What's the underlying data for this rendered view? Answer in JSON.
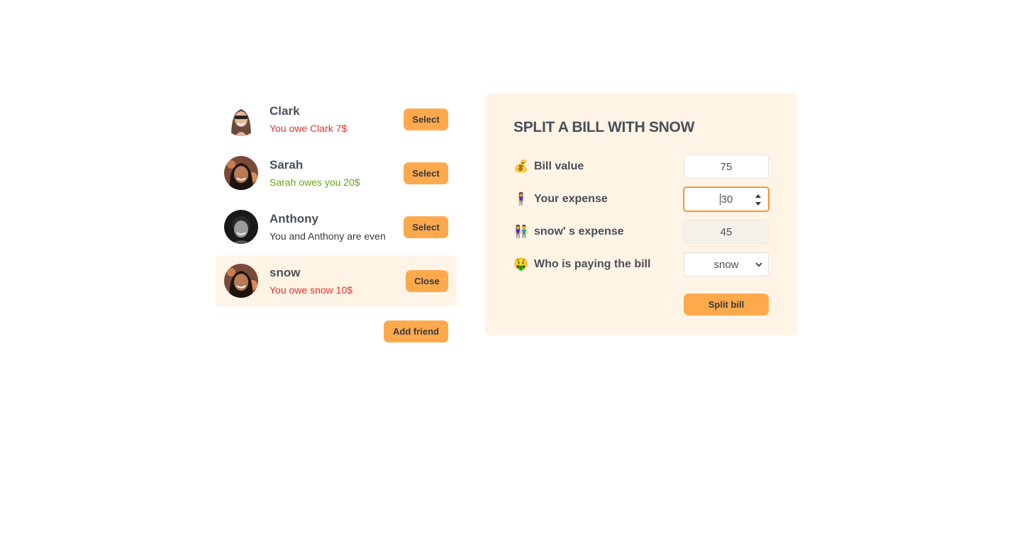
{
  "friends": [
    {
      "name": "Clark",
      "status": "You owe Clark 7$",
      "status_type": "red",
      "button": "Select",
      "selected": false
    },
    {
      "name": "Sarah",
      "status": "Sarah owes you 20$",
      "status_type": "green",
      "button": "Select",
      "selected": false
    },
    {
      "name": "Anthony",
      "status": "You and Anthony are even",
      "status_type": "even",
      "button": "Select",
      "selected": false
    },
    {
      "name": "snow",
      "status": "You owe snow 10$",
      "status_type": "red",
      "button": "Close",
      "selected": true
    }
  ],
  "add_friend_label": "Add friend",
  "form": {
    "title": "SPLIT A BILL WITH SNOW",
    "bill_value": {
      "emoji": "💰",
      "label": "Bill value",
      "value": "75"
    },
    "your_expense": {
      "emoji": "🧍‍♀️",
      "label": "Your expense",
      "value": "30"
    },
    "friend_expense": {
      "emoji": "👫",
      "label": "snow' s expense",
      "value": "45"
    },
    "who_pays": {
      "emoji": "🤑",
      "label": "Who is paying the bill",
      "value": "snow"
    },
    "submit_label": "Split bill"
  },
  "colors": {
    "accent": "#ffa94d",
    "panel": "#fff4e6",
    "owe": "#e03131",
    "owed": "#66a80f"
  }
}
